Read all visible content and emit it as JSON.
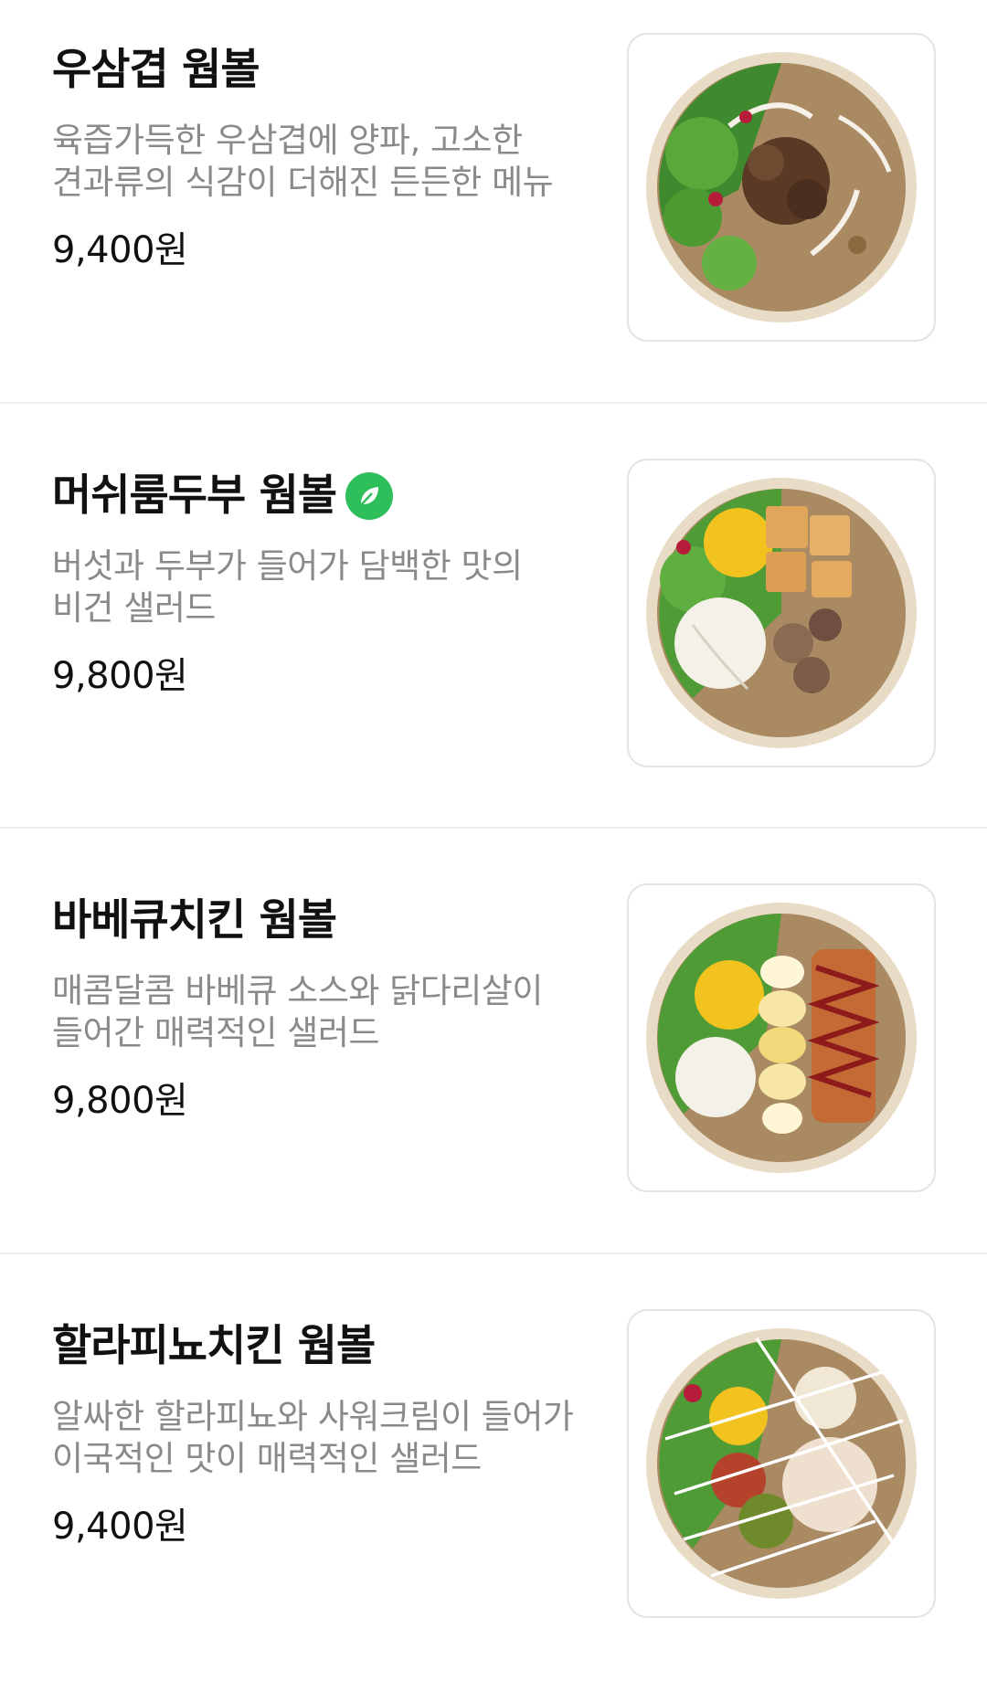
{
  "menu": {
    "items": [
      {
        "name": "우삼겹 웜볼",
        "description_lines": [
          "육즙가득한 우삼겹에 양파, 고소한",
          "견과류의 식감이 더해진 든든한 메뉴"
        ],
        "price": "9,400원",
        "vegan": false,
        "image_icon": "salad-bowl-beef-image"
      },
      {
        "name": "머쉬룸두부 웜볼",
        "description_lines": [
          "버섯과 두부가 들어가 담백한 맛의",
          "비건 샐러드"
        ],
        "price": "9,800원",
        "vegan": true,
        "badge_icon": "leaf-icon",
        "image_icon": "salad-bowl-mushroom-tofu-image"
      },
      {
        "name": "바베큐치킨 웜볼",
        "description_lines": [
          "매콤달콤 바베큐 소스와 닭다리살이",
          "들어간 매력적인 샐러드"
        ],
        "price": "9,800원",
        "vegan": false,
        "image_icon": "salad-bowl-bbq-chicken-image"
      },
      {
        "name": "할라피뇨치킨 웜볼",
        "description_lines": [
          "알싸한 할라피뇨와 사워크림이 들어가",
          "이국적인 맛이 매력적인 샐러드"
        ],
        "price": "9,400원",
        "vegan": false,
        "image_icon": "salad-bowl-jalapeno-chicken-image"
      }
    ]
  },
  "colors": {
    "vegan_badge": "#2fbf5a",
    "description_text": "#8a8a8a",
    "separator": "#efefef"
  }
}
